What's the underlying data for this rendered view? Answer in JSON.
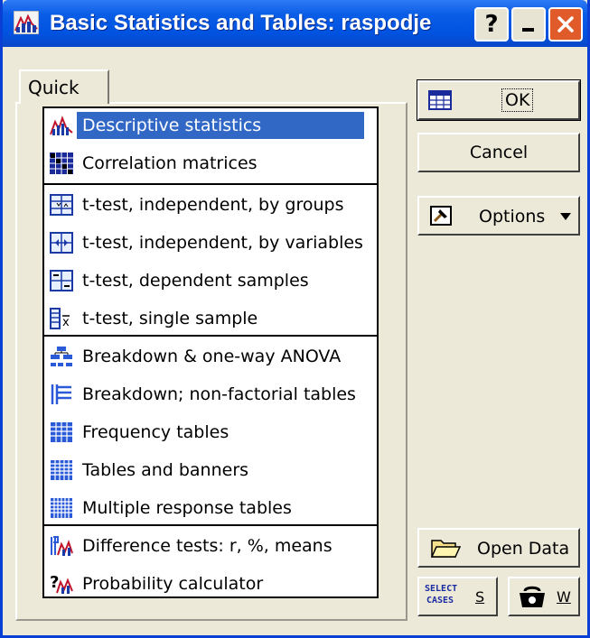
{
  "window": {
    "title": "Basic Statistics and Tables: raspodje",
    "help_glyph": "?",
    "colors": {
      "titlebar": "#0a5de6",
      "selection": "#3168c6",
      "close": "#e05a2a"
    }
  },
  "tabs": [
    {
      "label": "Quick",
      "active": true
    }
  ],
  "list": {
    "items": [
      {
        "label": "Descriptive statistics",
        "icon": "descriptive-stats-icon",
        "selected": true
      },
      {
        "label": "Correlation matrices",
        "icon": "correlation-matrix-icon"
      },
      {
        "label": "t-test, independent, by groups",
        "icon": "ttest-groups-icon"
      },
      {
        "label": "t-test, independent, by variables",
        "icon": "ttest-variables-icon"
      },
      {
        "label": "t-test, dependent samples",
        "icon": "ttest-dependent-icon"
      },
      {
        "label": "t-test, single sample",
        "icon": "ttest-single-icon"
      },
      {
        "label": "Breakdown & one-way ANOVA",
        "icon": "breakdown-anova-icon"
      },
      {
        "label": "Breakdown; non-factorial tables",
        "icon": "breakdown-nonfactorial-icon"
      },
      {
        "label": "Frequency tables",
        "icon": "frequency-table-icon"
      },
      {
        "label": "Tables and banners",
        "icon": "tables-banners-icon"
      },
      {
        "label": "Multiple response tables",
        "icon": "multiple-response-icon"
      },
      {
        "label": "Difference tests: r, %, means",
        "icon": "difference-tests-icon"
      },
      {
        "label": "Probability calculator",
        "icon": "probability-calculator-icon"
      }
    ]
  },
  "buttons": {
    "ok": "OK",
    "cancel": "Cancel",
    "options": "Options",
    "open_data": "Open Data",
    "select_cases_icon": "SELECT CASES",
    "select_cases": "S",
    "weight": "W"
  }
}
